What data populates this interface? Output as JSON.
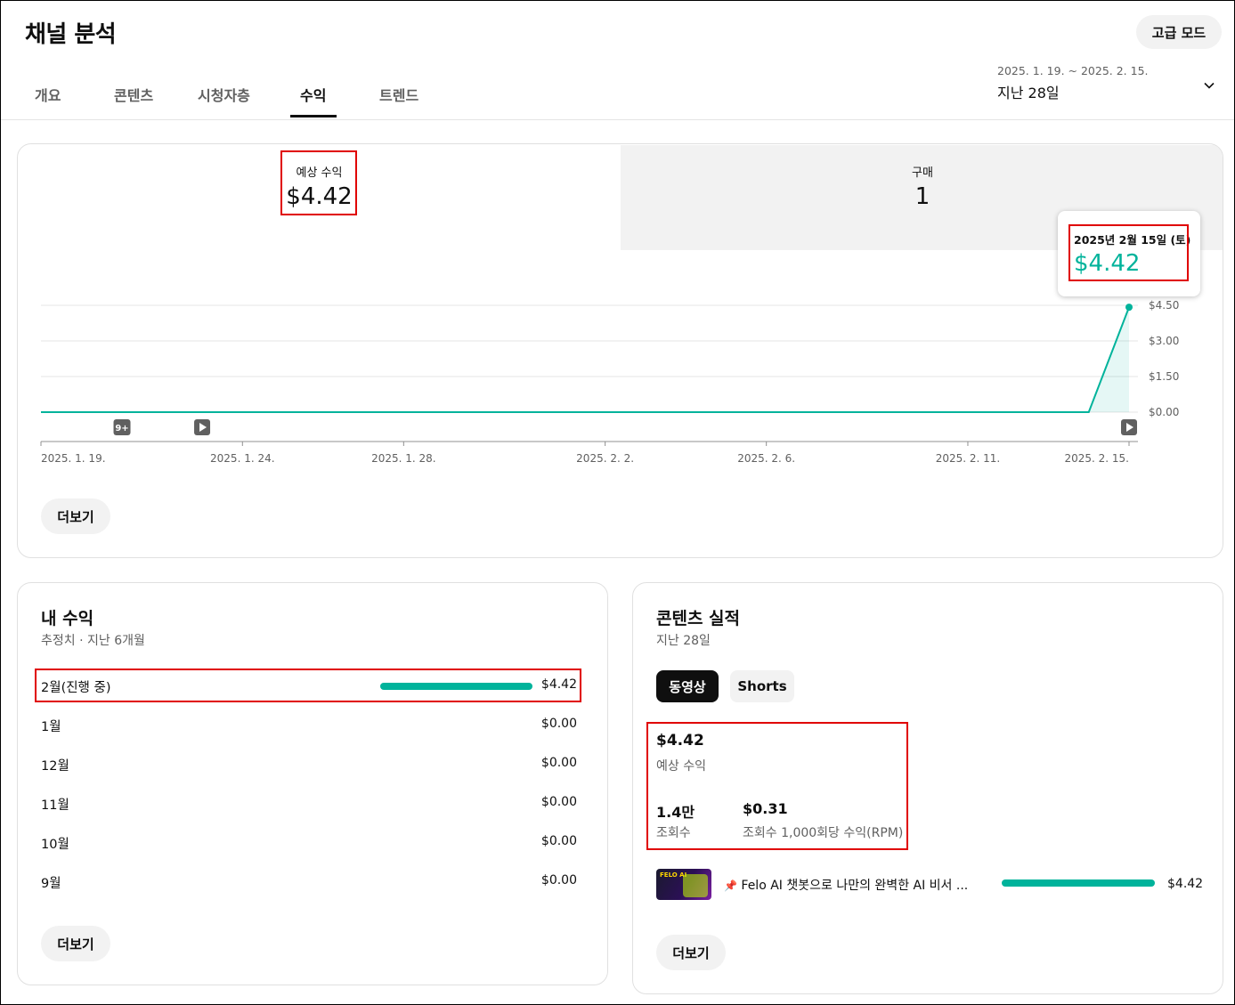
{
  "header": {
    "title": "채널 분석",
    "advanced_mode": "고급 모드",
    "tabs": [
      "개요",
      "콘텐츠",
      "시청자층",
      "수익",
      "트렌드"
    ],
    "active_tab": "수익",
    "date_range": "2025. 1. 19. ~ 2025. 2. 15.",
    "date_label": "지난 28일"
  },
  "overview": {
    "metrics": [
      {
        "label": "예상 수익",
        "value": "$4.42",
        "selected": true
      },
      {
        "label": "구매",
        "value": "1",
        "selected": false
      }
    ],
    "tooltip": {
      "date": "2025년 2월 15일 (토)",
      "value": "$4.42"
    },
    "markers": [
      "9+"
    ],
    "more": "더보기"
  },
  "chart_data": {
    "type": "line",
    "title": "",
    "x": [
      "2025. 1. 19.",
      "2025. 1. 20.",
      "2025. 1. 21.",
      "2025. 1. 22.",
      "2025. 1. 23.",
      "2025. 1. 24.",
      "2025. 1. 25.",
      "2025. 1. 26.",
      "2025. 1. 27.",
      "2025. 1. 28.",
      "2025. 1. 29.",
      "2025. 1. 30.",
      "2025. 1. 31.",
      "2025. 2. 1.",
      "2025. 2. 2.",
      "2025. 2. 3.",
      "2025. 2. 4.",
      "2025. 2. 5.",
      "2025. 2. 6.",
      "2025. 2. 7.",
      "2025. 2. 8.",
      "2025. 2. 9.",
      "2025. 2. 10.",
      "2025. 2. 11.",
      "2025. 2. 12.",
      "2025. 2. 13.",
      "2025. 2. 14.",
      "2025. 2. 15."
    ],
    "series": [
      {
        "values": [
          0,
          0,
          0,
          0,
          0,
          0,
          0,
          0,
          0,
          0,
          0,
          0,
          0,
          0,
          0,
          0,
          0,
          0,
          0,
          0,
          0,
          0,
          0,
          0,
          0,
          0,
          0,
          4.42
        ]
      }
    ],
    "x_tick_labels": [
      "2025. 1. 19.",
      "2025. 1. 24.",
      "2025. 1. 28.",
      "2025. 2. 2.",
      "2025. 2. 6.",
      "2025. 2. 11.",
      "2025. 2. 15."
    ],
    "y_tick_labels": [
      "$0.00",
      "$1.50",
      "$3.00",
      "$4.50"
    ],
    "ylim": [
      0,
      4.5
    ],
    "grid": true,
    "color": "#00b39b"
  },
  "my_revenue": {
    "title": "내 수익",
    "subtitle": "추정치 · 지난 6개월",
    "rows": [
      {
        "month": "2월(진행 중)",
        "amount": "$4.42",
        "fraction": 1.0
      },
      {
        "month": "1월",
        "amount": "$0.00",
        "fraction": 0
      },
      {
        "month": "12월",
        "amount": "$0.00",
        "fraction": 0
      },
      {
        "month": "11월",
        "amount": "$0.00",
        "fraction": 0
      },
      {
        "month": "10월",
        "amount": "$0.00",
        "fraction": 0
      },
      {
        "month": "9월",
        "amount": "$0.00",
        "fraction": 0
      }
    ],
    "more": "더보기"
  },
  "content_performance": {
    "title": "콘텐츠 실적",
    "subtitle": "지난 28일",
    "chips": [
      "동영상",
      "Shorts"
    ],
    "active_chip": "동영상",
    "revenue_value": "$4.42",
    "revenue_label": "예상 수익",
    "views_value": "1.4만",
    "views_label": "조회수",
    "rpm_value": "$0.31",
    "rpm_label": "조회수 1,000회당 수익(RPM)",
    "video": {
      "pin_icon": "📌",
      "title": "Felo AI 챗봇으로 나만의 완벽한 AI 비서 ...",
      "amount": "$4.42",
      "fraction": 1.0,
      "thumb_text": "FELO AI"
    },
    "more": "더보기"
  }
}
